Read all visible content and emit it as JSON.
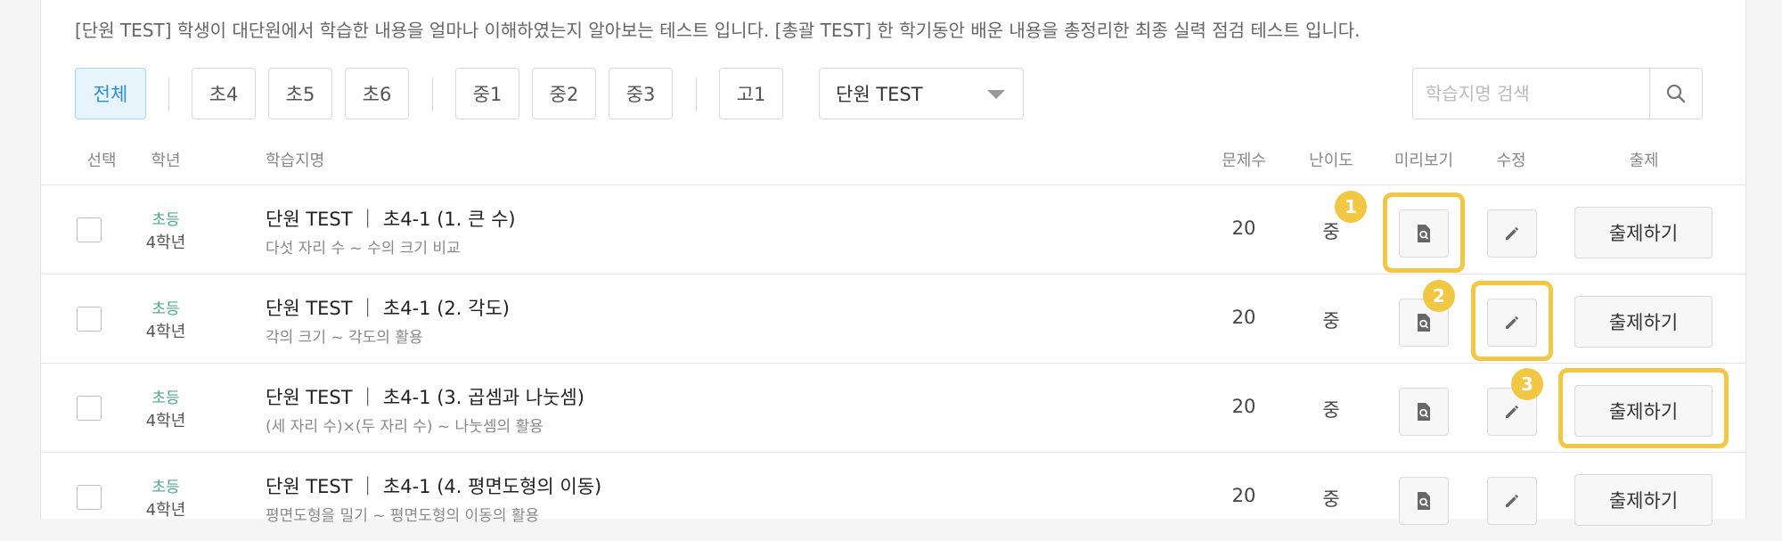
{
  "description": "[단원 TEST] 학생이 대단원에서 학습한 내용을 얼마나 이해하였는지 알아보는 테스트 입니다. [총괄 TEST] 한 학기동안 배운 내용을 총정리한 최종 실력 점검 테스트 입니다.",
  "filters": {
    "all": "전체",
    "e4": "초4",
    "e5": "초5",
    "e6": "초6",
    "m1": "중1",
    "m2": "중2",
    "m3": "중3",
    "h1": "고1",
    "test_type": "단원 TEST"
  },
  "search": {
    "placeholder": "학습지명 검색"
  },
  "columns": {
    "select": "선택",
    "grade": "학년",
    "name": "학습지명",
    "count": "문제수",
    "difficulty": "난이도",
    "preview": "미리보기",
    "edit": "수정",
    "assign": "출제"
  },
  "rows": [
    {
      "level": "초등",
      "grade": "4학년",
      "title": "단원 TEST ｜ 초4-1 (1. 큰 수)",
      "subtitle": "다섯 자리 수 ~ 수의 크기 비교",
      "count": "20",
      "difficulty": "중",
      "assign_label": "출제하기"
    },
    {
      "level": "초등",
      "grade": "4학년",
      "title": "단원 TEST ｜ 초4-1 (2. 각도)",
      "subtitle": "각의 크기 ~ 각도의 활용",
      "count": "20",
      "difficulty": "중",
      "assign_label": "출제하기"
    },
    {
      "level": "초등",
      "grade": "4학년",
      "title": "단원 TEST ｜ 초4-1 (3. 곱셈과 나눗셈)",
      "subtitle": "(세 자리 수)×(두 자리 수) ~ 나눗셈의 활용",
      "count": "20",
      "difficulty": "중",
      "assign_label": "출제하기"
    },
    {
      "level": "초등",
      "grade": "4학년",
      "title": "단원 TEST ｜ 초4-1 (4. 평면도형의 이동)",
      "subtitle": "평면도형을 밀기 ~ 평면도형의 이동의 활용",
      "count": "20",
      "difficulty": "중",
      "assign_label": "출제하기"
    }
  ],
  "callouts": [
    "1",
    "2",
    "3"
  ],
  "colors": {
    "highlight": "#f2c744",
    "level_text": "#4aa88a",
    "active_filter": "#2b8fd6"
  },
  "icons": {
    "search": "search-icon",
    "preview": "document-preview-icon",
    "edit": "pencil-icon",
    "dropdown": "caret-down-icon"
  }
}
